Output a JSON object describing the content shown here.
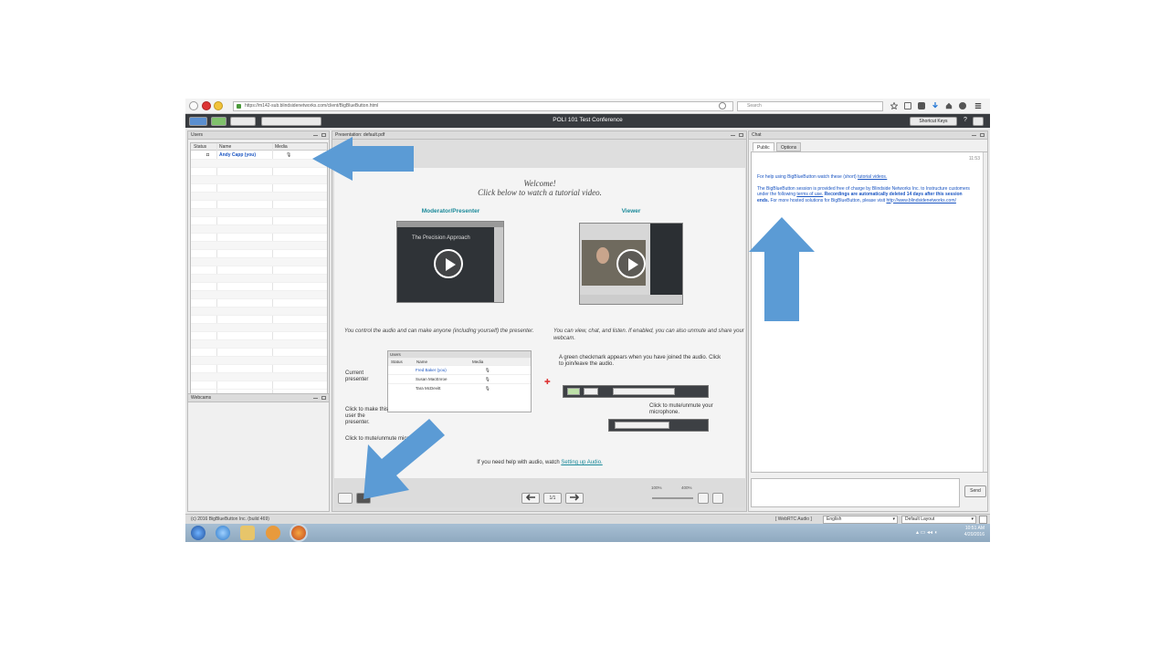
{
  "browser": {
    "url": "https://m142-sub.blindsidenetworks.com/client/BigBlueButton.html",
    "search_placeholder": "Search"
  },
  "app": {
    "title": "POLI 101 Test Conference",
    "shortcut_label": "Shortcut Keys",
    "help_label": "?"
  },
  "users": {
    "title": "Users",
    "columns": [
      "Status",
      "Name",
      "Media"
    ],
    "rows": [
      {
        "name": "Andy Capp (you)"
      }
    ]
  },
  "webcams": {
    "title": "Webcams"
  },
  "presentation": {
    "title": "Presentation: default.pdf",
    "welcome_line1": "Welcome!",
    "welcome_line2": "Click below to watch a tutorial video.",
    "moderator_title": "Moderator/Presenter",
    "viewer_title": "Viewer",
    "video_caption": "The Precision Approach",
    "moderator_desc": "You control the audio and can make anyone (including yourself) the presenter.",
    "viewer_desc": "You can view, chat, and listen.  If enabled, you can also unmute and share your webcam.",
    "mini_users_title": "Users",
    "mini_cols": [
      "Status",
      "Name",
      "Media"
    ],
    "mini_rows": [
      "Fred Baker (you)",
      "Susan MacEnroe",
      "Tara McDevitt"
    ],
    "current_presenter": "Current presenter",
    "click_make_presenter": "Click to make this user the presenter.",
    "click_mute_bottom": "Click to mute/unmute microphone.",
    "green_checkmark_note": "A green checkmark appears when you have joined the audio.  Click to join/leave the audio.",
    "mute_note": "Click to mute/unmute your microphone.",
    "help_text": "If you need help with audio, watch",
    "help_link": "Setting up Audio.",
    "page_number": "1/1",
    "zoom_min": "100%",
    "zoom_max": "400%"
  },
  "chat": {
    "title": "Chat",
    "tabs": [
      "Public",
      "Options"
    ],
    "timestamp": "11:53",
    "msg1_prefix": "For help using BigBlueButton watch these (short)",
    "msg1_link": "tutorial videos.",
    "msg2_a": "The BigBlueButton session is provided free of charge by Blindside Networks Inc. to Instructure customers under the following",
    "msg2_link": "terms of use.",
    "msg2_bold": "Recordings are automatically deleted 14 days after this session ends.",
    "msg2_b": "For more hosted solutions for BigBlueButton, please visit",
    "msg2_link2": "http://www.blindsidenetworks.com/",
    "send_label": "Send"
  },
  "statusbar": {
    "copyright": "(c) 2016 BigBlueButton Inc. (build 469)",
    "webrtc": "[ WebRTC Audio ]",
    "language": "English",
    "layout": "Default Layout"
  },
  "taskbar": {
    "time": "10:51 AM",
    "date": "4/20/2016"
  },
  "colors": {
    "annotation_arrow": "#5b9bd5",
    "app_bar": "#383b3f",
    "chat_text": "#1a55c2",
    "tutorial_heading": "#1b8a9a"
  }
}
